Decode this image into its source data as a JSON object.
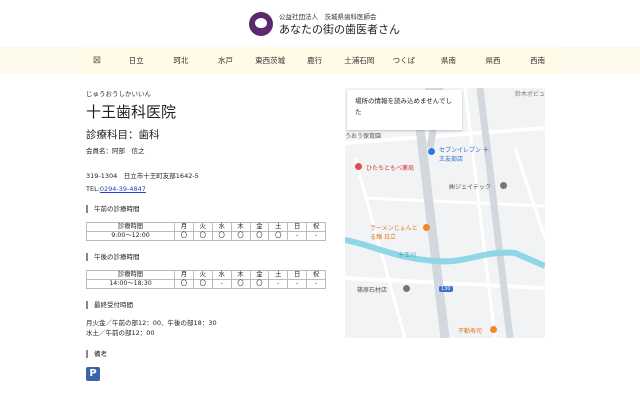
{
  "header": {
    "org": "公益社団法人　茨城県歯科医師会",
    "title": "あなたの街の歯医者さん"
  },
  "nav": {
    "home_icon": "home-icon",
    "items": [
      "日立",
      "珂北",
      "水戸",
      "東西茨城",
      "鹿行",
      "土浦石岡",
      "つくば",
      "県南",
      "県西",
      "西南"
    ]
  },
  "clinic": {
    "kana": "じゅうおうしかいいん",
    "name": "十王歯科医院",
    "department": "診療科目：歯科",
    "member": "会員名：阿部　信之",
    "address": "319-1304　日立市十王町友部1642-5",
    "tel_label": "TEL:",
    "tel": "0294-39-4847"
  },
  "morning": {
    "heading": "午前の診療時間",
    "columns": [
      "診療時間",
      "月",
      "火",
      "水",
      "木",
      "金",
      "土",
      "日",
      "祝"
    ],
    "row": [
      "9:00〜12:00",
      "〇",
      "〇",
      "〇",
      "〇",
      "〇",
      "〇",
      "-",
      "-"
    ]
  },
  "afternoon": {
    "heading": "午後の診療時間",
    "columns": [
      "診療時間",
      "月",
      "火",
      "水",
      "木",
      "金",
      "土",
      "日",
      "祝"
    ],
    "row": [
      "14:00〜18:30",
      "〇",
      "〇",
      "-",
      "〇",
      "〇",
      "-",
      "-",
      "-"
    ]
  },
  "last_reception": {
    "heading": "最終受付時間",
    "lines": [
      "月火金／午前の部12：00、午後の部18：30",
      "水土／午前の部12：00"
    ]
  },
  "notes": {
    "heading": "備考",
    "parking_icon": "P"
  },
  "map": {
    "error": "場所の情報を読み込めませんでした",
    "labels": [
      "鈴木ボビュ ジャズ音楽",
      "うおう保育園",
      "セブンイレブン 十王友部店",
      "ひたちともべ薬局",
      "㈱ジェイテック",
      "ラーメンじょんとる麺 日立",
      "十王川",
      "篠原石材店",
      "不動寿司",
      "130"
    ]
  }
}
